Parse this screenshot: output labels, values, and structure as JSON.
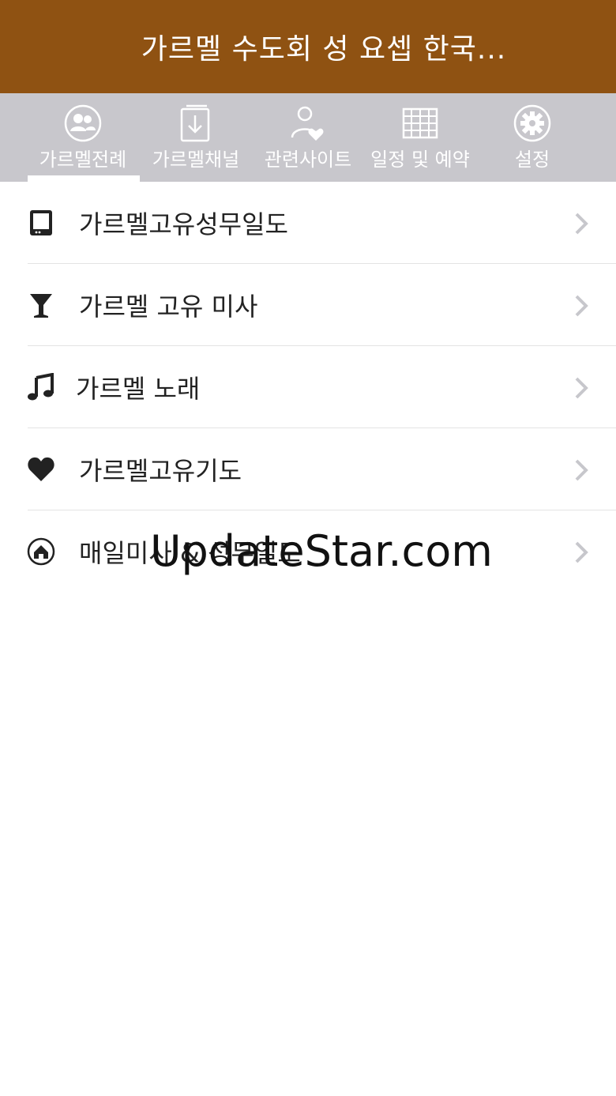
{
  "header": {
    "title": "가르멜 수도회 성 요셉 한국..."
  },
  "tabs": [
    {
      "label": "가르멜전례",
      "icon": "people-circle-icon",
      "active": true
    },
    {
      "label": "가르멜채널",
      "icon": "download-icon",
      "active": false
    },
    {
      "label": "관련사이트",
      "icon": "person-heart-icon",
      "active": false
    },
    {
      "label": "일정 및 예약",
      "icon": "calendar-grid-icon",
      "active": false
    },
    {
      "label": "설정",
      "icon": "gear-icon",
      "active": false
    }
  ],
  "list": [
    {
      "label": "가르멜고유성무일도",
      "icon": "tablet-icon"
    },
    {
      "label": "가르멜 고유 미사",
      "icon": "chalice-icon"
    },
    {
      "label": "가르멜 노래",
      "icon": "music-note-icon"
    },
    {
      "label": "가르멜고유기도",
      "icon": "heart-icon"
    },
    {
      "label": "매일미사 & 성무일도",
      "icon": "home-circle-icon"
    }
  ],
  "watermark": {
    "text": "UpdateStar.com"
  },
  "colors": {
    "header": "#8f5212",
    "tabbar": "#c8c7cc",
    "text": "#222222",
    "chevron": "#c7c7cc"
  }
}
